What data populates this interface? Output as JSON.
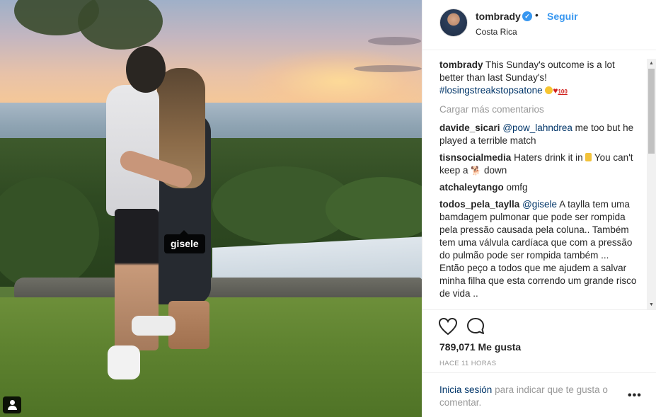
{
  "photo": {
    "tag_label": "gisele",
    "tag_icon": "user-tag-icon"
  },
  "header": {
    "username": "tombrady",
    "verified_icon": "verified-badge-icon",
    "separator": "•",
    "follow_label": "Seguir",
    "location": "Costa Rica"
  },
  "caption": {
    "user": "tombrady",
    "text": "This Sunday's outcome is a lot better than last Sunday's!",
    "hashtag": "#losingstreakstopsatone",
    "emojis": [
      "laughing-face-emoji",
      "red-heart-emoji",
      "hundred-points-emoji"
    ]
  },
  "load_more": "Cargar más comentarios",
  "comments": [
    {
      "user": "davide_sicari",
      "mention": "@pow_lahndrea",
      "text": "me too but he played a terrible match"
    },
    {
      "user": "tisnsocialmedia",
      "text_a": "Haters drink it in",
      "text_b": "You can't keep a",
      "text_c": "down"
    },
    {
      "user": "atchaleytango",
      "text": "omfg"
    },
    {
      "user": "todos_pela_taylla",
      "mention": "@gisele",
      "text": "A taylla tem uma bamdagem pulmonar que pode ser rompida pela pressão causada pela coluna.. Também tem uma válvula cardíaca que com a pressão do pulmão pode ser rompida também ...",
      "text2": "Então peço a todos que me ajudem a salvar minha filha que esta correndo um grande risco de vida .."
    }
  ],
  "actions": {
    "like_icon": "heart-icon",
    "comment_icon": "comment-bubble-icon",
    "likes": "789,071 Me gusta",
    "time": "HACE 11 HORAS"
  },
  "login": {
    "link": "Inicia sesión",
    "text": "para indicar que te gusta o comentar.",
    "more_label": "•••"
  },
  "colors": {
    "link_blue": "#3897f0",
    "dark_link": "#003569",
    "muted": "#999999",
    "text": "#262626"
  }
}
